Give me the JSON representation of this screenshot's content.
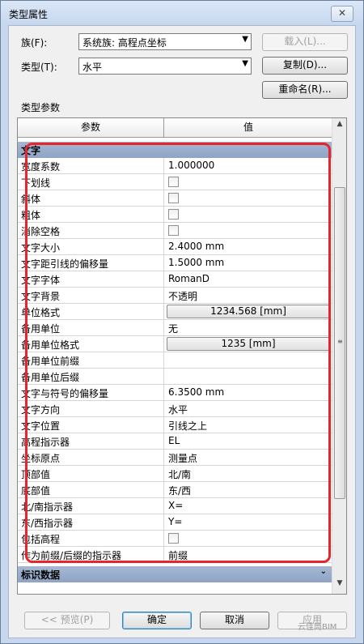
{
  "window": {
    "title": "类型属性",
    "close_label": "✕"
  },
  "family": {
    "label": "族(F):",
    "value": "系统族: 高程点坐标",
    "load_button": "载入(L)..."
  },
  "type": {
    "label": "类型(T):",
    "value": "水平",
    "duplicate_button": "复制(D)...",
    "rename_button": "重命名(R)..."
  },
  "section_label": "类型参数",
  "grid": {
    "header": {
      "param": "参数",
      "value": "值"
    },
    "group_text": "文字",
    "rows": [
      {
        "name": "宽度系数",
        "value": "1.000000",
        "kind": "text"
      },
      {
        "name": "下划线",
        "value": "",
        "kind": "checkbox"
      },
      {
        "name": "斜体",
        "value": "",
        "kind": "checkbox"
      },
      {
        "name": "粗体",
        "value": "",
        "kind": "checkbox"
      },
      {
        "name": "消除空格",
        "value": "",
        "kind": "checkbox"
      },
      {
        "name": "文字大小",
        "value": "2.4000 mm",
        "kind": "text"
      },
      {
        "name": "文字距引线的偏移量",
        "value": "1.5000 mm",
        "kind": "text"
      },
      {
        "name": "文字字体",
        "value": "RomanD",
        "kind": "text"
      },
      {
        "name": "文字背景",
        "value": "不透明",
        "kind": "text"
      },
      {
        "name": "单位格式",
        "value": "1234.568 [mm]",
        "kind": "button"
      },
      {
        "name": "备用单位",
        "value": "无",
        "kind": "text"
      },
      {
        "name": "备用单位格式",
        "value": "1235 [mm]",
        "kind": "button"
      },
      {
        "name": "备用单位前缀",
        "value": "",
        "kind": "text"
      },
      {
        "name": "备用单位后缀",
        "value": "",
        "kind": "text"
      },
      {
        "name": "文字与符号的偏移量",
        "value": "6.3500 mm",
        "kind": "text"
      },
      {
        "name": "文字方向",
        "value": "水平",
        "kind": "text"
      },
      {
        "name": "文字位置",
        "value": "引线之上",
        "kind": "text"
      },
      {
        "name": "高程指示器",
        "value": "EL",
        "kind": "text"
      },
      {
        "name": "坐标原点",
        "value": "测量点",
        "kind": "text"
      },
      {
        "name": "顶部值",
        "value": "北/南",
        "kind": "text"
      },
      {
        "name": "底部值",
        "value": "东/西",
        "kind": "text"
      },
      {
        "name": "北/南指示器",
        "value": "X=",
        "kind": "text"
      },
      {
        "name": "东/西指示器",
        "value": "Y=",
        "kind": "text"
      },
      {
        "name": "包括高程",
        "value": "",
        "kind": "checkbox"
      },
      {
        "name": "作为前缀/后缀的指示器",
        "value": "前缀",
        "kind": "text"
      }
    ],
    "group_identity": "标识数据"
  },
  "footer": {
    "preview": "<< 预览(P)",
    "ok": "确定",
    "cancel": "取消",
    "apply": "应用"
  },
  "watermark": "云佳筒BIM",
  "colors": {
    "highlight": "#e8242d",
    "group_header": "#8fa4c6"
  }
}
